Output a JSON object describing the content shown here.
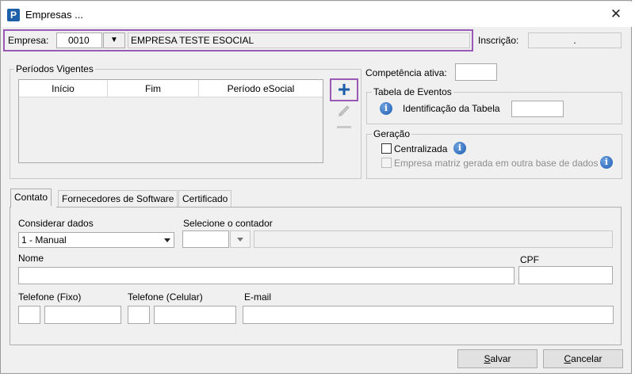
{
  "window": {
    "title": "Empresas ...",
    "close_glyph": "✕",
    "app_icon_letter": "P"
  },
  "empresa": {
    "label": "Empresa:",
    "code": "0010",
    "name": "EMPRESA TESTE ESOCIAL",
    "dropdown_glyph": "▼",
    "inscricao_label": "Inscrição:",
    "inscricao_value": "."
  },
  "periodos": {
    "legend": "Períodos Vigentes",
    "columns": [
      "Início",
      "Fim",
      "Período eSocial"
    ],
    "rows": [],
    "add_glyph": "+",
    "edit_icon": "pencil-icon",
    "remove_glyph": "—"
  },
  "competencia": {
    "label": "Competência ativa:",
    "value": ""
  },
  "tabela_eventos": {
    "legend": "Tabela de Eventos",
    "id_label": "Identificação da Tabela",
    "id_value": "",
    "info_icon": "info-icon"
  },
  "geracao": {
    "legend": "Geração",
    "centralizada_label": "Centralizada",
    "centralizada_checked": false,
    "matriz_label": "Empresa matriz gerada em outra base de dados",
    "matriz_checked": false,
    "info_icon": "info-icon"
  },
  "tabs": [
    {
      "label": "Contato",
      "active": true
    },
    {
      "label": "Fornecedores de Software",
      "active": false
    },
    {
      "label": "Certificado",
      "active": false
    }
  ],
  "contato": {
    "considerar_label": "Considerar dados",
    "considerar_value": "1 - Manual",
    "contador_label": "Selecione o contador",
    "contador_code": "",
    "contador_name": "",
    "nome_label": "Nome",
    "nome_value": "",
    "cpf_label": "CPF",
    "cpf_value": "",
    "tel_fixo_label": "Telefone (Fixo)",
    "tel_fixo_ddd": "",
    "tel_fixo_numero": "",
    "tel_cel_label": "Telefone (Celular)",
    "tel_cel_ddd": "",
    "tel_cel_numero": "",
    "email_label": "E-mail",
    "email_value": ""
  },
  "buttons": {
    "salvar_prefix": "",
    "salvar_u": "S",
    "salvar_rest": "alvar",
    "cancelar_prefix": "",
    "cancelar_u": "C",
    "cancelar_rest": "ancelar"
  },
  "colors": {
    "highlight": "#9b59b6",
    "add_button": "#1d5fa8",
    "info": "#1d5bb0"
  }
}
